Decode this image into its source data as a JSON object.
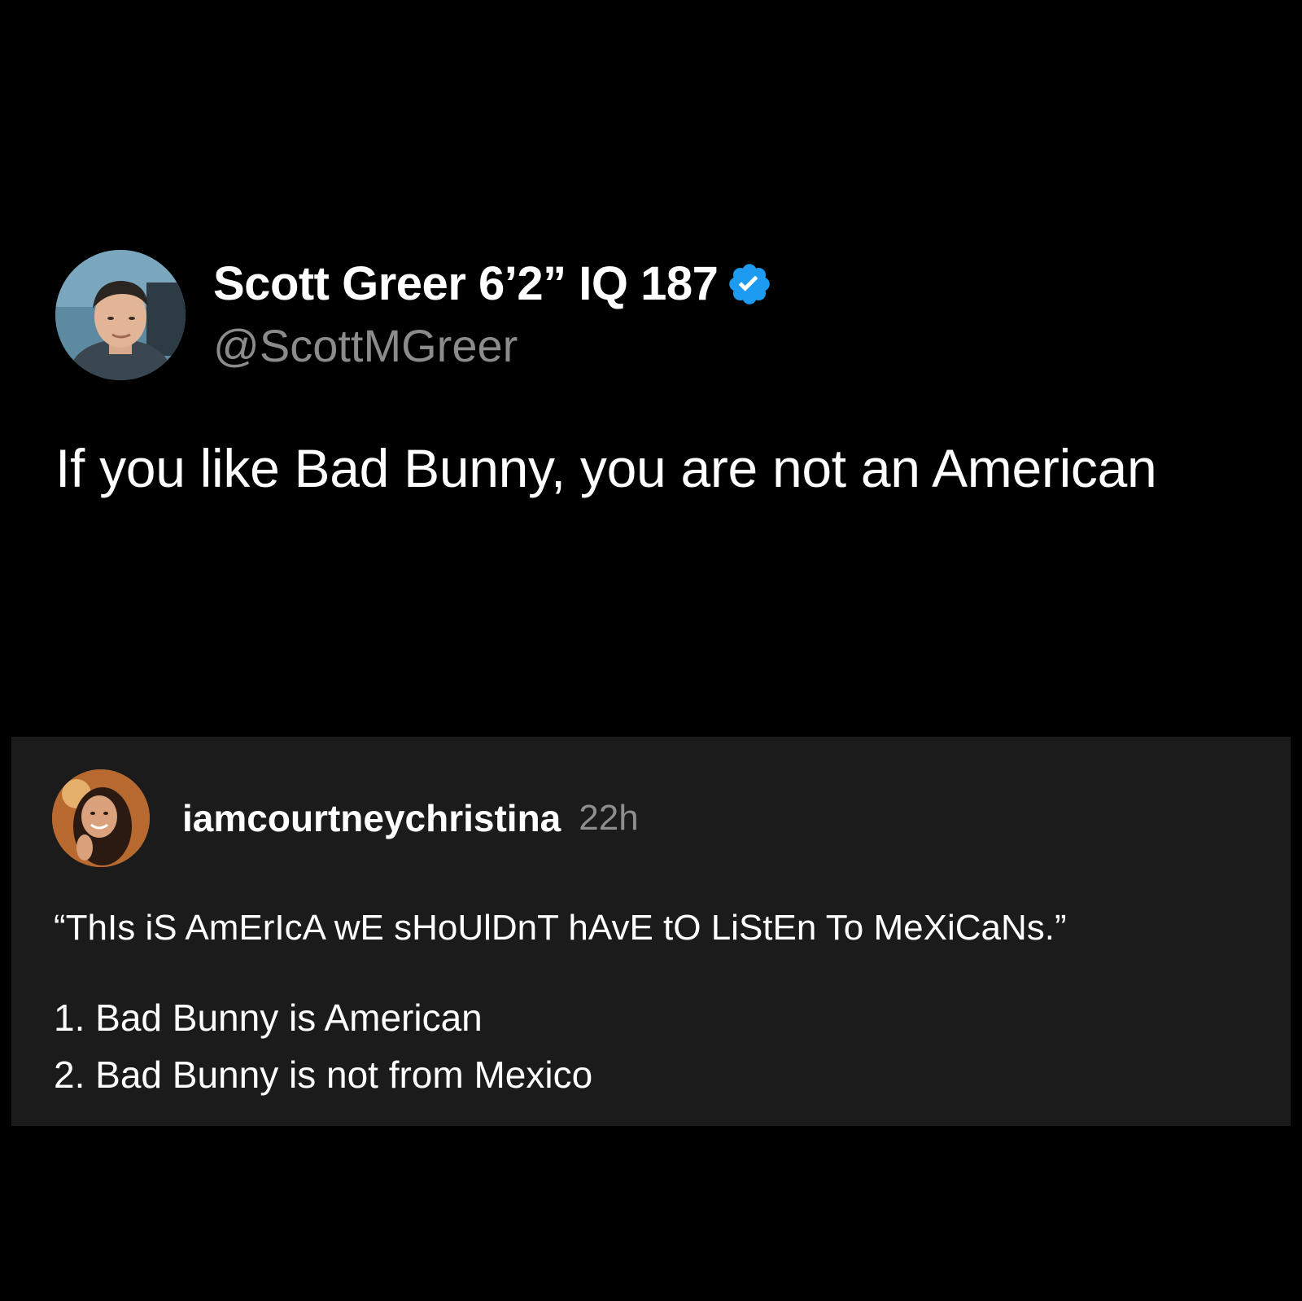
{
  "tweet": {
    "author_name": "Scott Greer 6’2” IQ 187",
    "handle": "@ScottMGreer",
    "text": "If you like Bad Bunny, you are not an American",
    "verified_color": "#1d9bf0"
  },
  "comment": {
    "username": "iamcourtneychristina",
    "time": "22h",
    "quote": "“ThIs iS AmErIcA wE sHoUlDnT hAvE tO LiStEn To MeXiCaNs.”",
    "points": [
      "1. Bad Bunny is American",
      "2. Bad Bunny is not from Mexico"
    ]
  },
  "colors": {
    "background": "#000000",
    "card_background": "#1b1b1b",
    "secondary_text": "#8b8b8b"
  }
}
